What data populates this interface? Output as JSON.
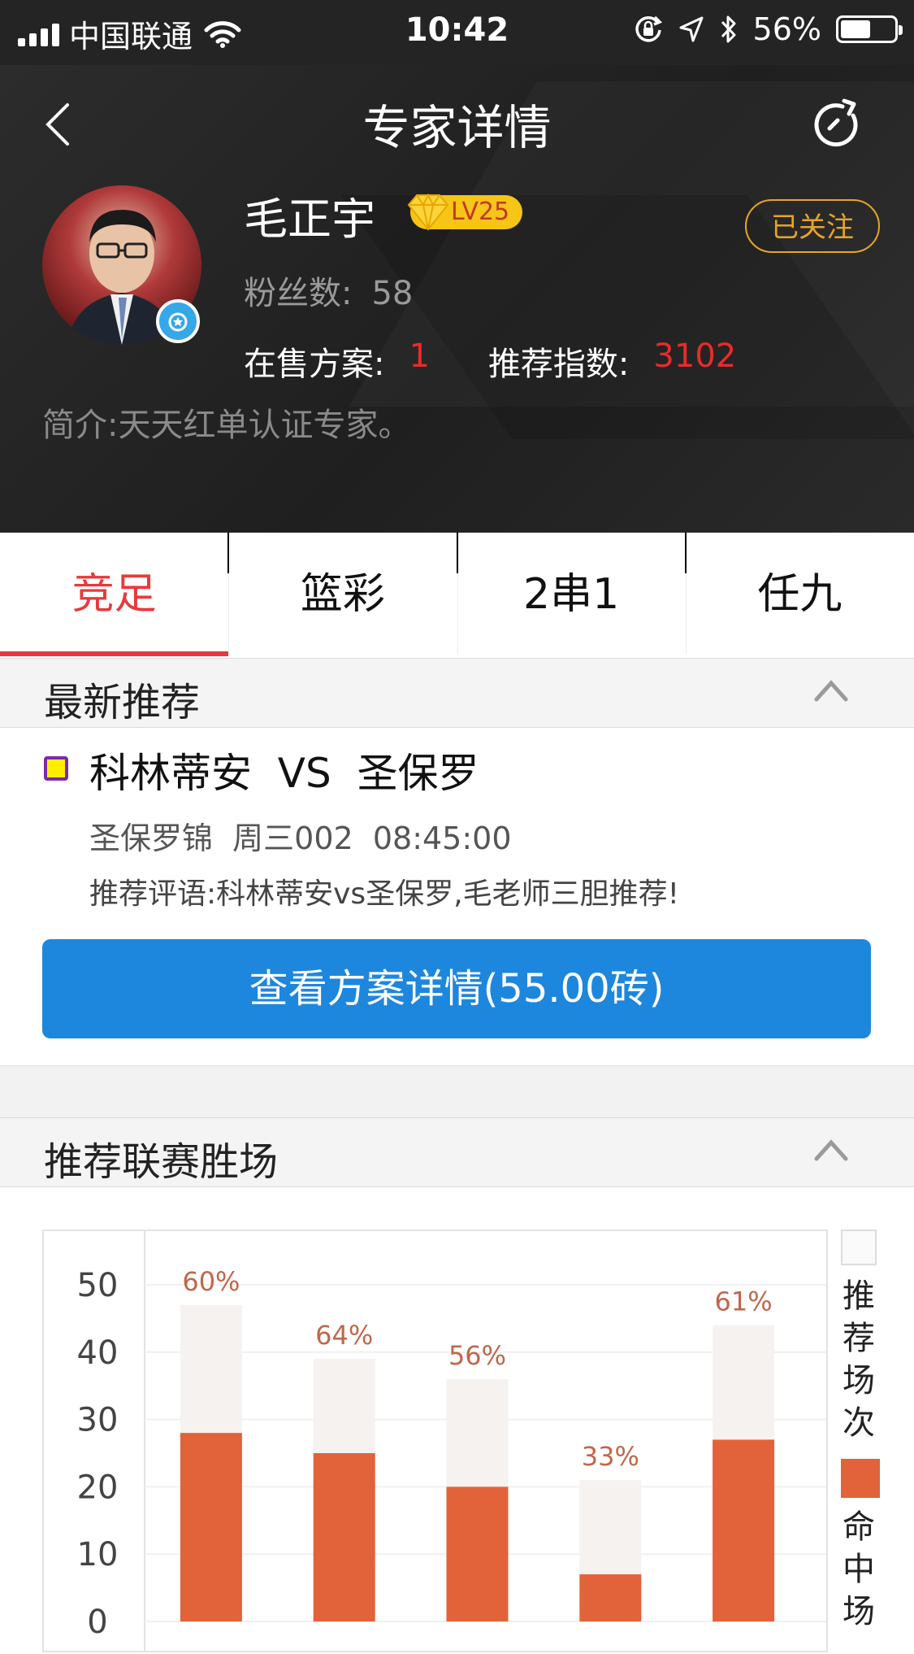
{
  "status_bar": {
    "carrier": "中国联通",
    "time": "10:42",
    "battery_percent": "56%",
    "battery_level": 0.56
  },
  "nav": {
    "title": "专家详情"
  },
  "profile": {
    "name": "毛正宇",
    "level": "LV25",
    "follow_label": "已关注",
    "fans_label": "粉丝数:",
    "fans_value": "58",
    "on_sale_label": "在售方案:",
    "on_sale_value": "1",
    "index_label": "推荐指数:",
    "index_value": "3102",
    "intro": "简介:天天红单认证专家。"
  },
  "tabs": [
    {
      "label": "竞足",
      "active": true
    },
    {
      "label": "篮彩",
      "active": false
    },
    {
      "label": "2串1",
      "active": false
    },
    {
      "label": "任九",
      "active": false
    }
  ],
  "latest": {
    "section_title": "最新推荐",
    "match": "科林蒂安  VS  圣保罗",
    "meta": "圣保罗锦  周三002  08:45:00",
    "comment": "推荐评语:科林蒂安vs圣保罗,毛老师三胆推荐!",
    "button_label": "查看方案详情(55.00砖)"
  },
  "league_section": {
    "section_title": "推荐联赛胜场"
  },
  "colors": {
    "accent_red": "#e8393a",
    "button_blue": "#1d87dd",
    "bar_hit": "#e2623a",
    "bar_total": "#f5f2f0",
    "follow_gold": "#e7a529"
  },
  "chart_data": {
    "type": "bar",
    "stacked": true,
    "y_ticks": [
      "0",
      "10",
      "20",
      "30",
      "40",
      "50"
    ],
    "ylim": [
      0,
      50
    ],
    "series": [
      {
        "name": "推荐场次",
        "values": [
          47,
          39,
          36,
          21,
          44
        ]
      },
      {
        "name": "命中场",
        "values": [
          28,
          25,
          20,
          7,
          27
        ]
      }
    ],
    "labels": [
      "60%",
      "64%",
      "56%",
      "33%",
      "61%"
    ],
    "legend": {
      "position": "right",
      "entries": [
        "推荐场次",
        "命中场"
      ]
    },
    "grid": true
  }
}
